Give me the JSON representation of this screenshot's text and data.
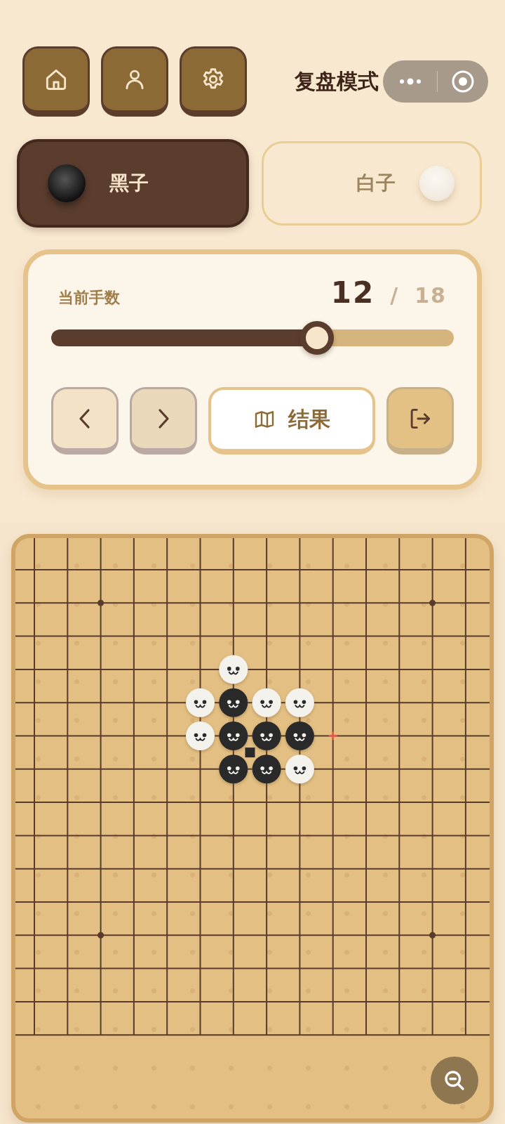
{
  "header": {
    "title": "复盘模式"
  },
  "players": [
    {
      "label": "黑子",
      "kind": "black",
      "selected": true
    },
    {
      "label": "白子",
      "kind": "white",
      "selected": false
    }
  ],
  "progress": {
    "label": "当前手数",
    "current": "12",
    "separator": "/",
    "total": "18",
    "level": 0.66
  },
  "actions": {
    "result_label": "结果"
  },
  "board": {
    "rows": [
      [
        {
          "kind": "empty"
        },
        {
          "kind": "empty"
        },
        {
          "kind": "empty"
        },
        {
          "kind": "empty"
        },
        {
          "kind": "empty"
        },
        {
          "kind": "empty"
        },
        {
          "kind": "empty"
        },
        {
          "kind": "empty"
        },
        {
          "kind": "empty"
        },
        {
          "kind": "empty"
        },
        {
          "kind": "empty"
        },
        {
          "kind": "empty"
        },
        {
          "kind": "empty"
        },
        {
          "kind": "empty"
        }
      ],
      [
        {
          "kind": "empty"
        },
        {
          "kind": "empty"
        },
        {
          "kind": "empty"
        },
        {
          "kind": "empty"
        },
        {
          "kind": "empty"
        },
        {
          "kind": "empty"
        },
        {
          "kind": "empty"
        },
        {
          "kind": "empty"
        },
        {
          "kind": "empty"
        },
        {
          "kind": "empty"
        },
        {
          "kind": "empty"
        },
        {
          "kind": "empty"
        },
        {
          "kind": "empty"
        },
        {
          "kind": "empty"
        }
      ],
      [
        {
          "kind": "empty"
        },
        {
          "kind": "empty"
        },
        {
          "kind": "empty"
        },
        {
          "kind": "empty"
        },
        {
          "kind": "empty"
        },
        {
          "kind": "empty"
        },
        {
          "kind": "empty"
        },
        {
          "kind": "empty"
        },
        {
          "kind": "empty"
        },
        {
          "kind": "empty"
        },
        {
          "kind": "empty"
        },
        {
          "kind": "empty"
        },
        {
          "kind": "empty"
        },
        {
          "kind": "empty"
        }
      ],
      [
        {
          "kind": "empty"
        },
        {
          "kind": "empty"
        },
        {
          "kind": "empty"
        },
        {
          "kind": "empty"
        },
        {
          "kind": "empty"
        },
        {
          "kind": "empty"
        },
        {
          "kind": "white"
        },
        {
          "kind": "empty"
        },
        {
          "kind": "empty"
        },
        {
          "kind": "empty"
        },
        {
          "kind": "empty"
        },
        {
          "kind": "empty"
        },
        {
          "kind": "empty"
        },
        {
          "kind": "empty"
        }
      ],
      [
        {
          "kind": "empty"
        },
        {
          "kind": "empty"
        },
        {
          "kind": "empty"
        },
        {
          "kind": "empty"
        },
        {
          "kind": "empty"
        },
        {
          "kind": "white"
        },
        {
          "kind": "black"
        },
        {
          "kind": "white"
        },
        {
          "kind": "white"
        },
        {
          "kind": "empty"
        },
        {
          "kind": "empty"
        },
        {
          "kind": "empty"
        },
        {
          "kind": "empty"
        },
        {
          "kind": "empty"
        }
      ],
      [
        {
          "kind": "empty"
        },
        {
          "kind": "empty"
        },
        {
          "kind": "empty"
        },
        {
          "kind": "empty"
        },
        {
          "kind": "empty"
        },
        {
          "kind": "white"
        },
        {
          "kind": "blackmarked"
        },
        {
          "kind": "black"
        },
        {
          "kind": "black"
        },
        {
          "kind": "hint"
        },
        {
          "kind": "empty"
        },
        {
          "kind": "empty"
        },
        {
          "kind": "empty"
        },
        {
          "kind": "empty"
        }
      ],
      [
        {
          "kind": "empty"
        },
        {
          "kind": "empty"
        },
        {
          "kind": "empty"
        },
        {
          "kind": "empty"
        },
        {
          "kind": "empty"
        },
        {
          "kind": "empty"
        },
        {
          "kind": "black"
        },
        {
          "kind": "black"
        },
        {
          "kind": "white"
        },
        {
          "kind": "empty"
        },
        {
          "kind": "empty"
        },
        {
          "kind": "empty"
        },
        {
          "kind": "empty"
        },
        {
          "kind": "empty"
        }
      ],
      [
        {
          "kind": "empty"
        },
        {
          "kind": "empty"
        },
        {
          "kind": "empty"
        },
        {
          "kind": "empty"
        },
        {
          "kind": "empty"
        },
        {
          "kind": "empty"
        },
        {
          "kind": "empty"
        },
        {
          "kind": "empty"
        },
        {
          "kind": "empty"
        },
        {
          "kind": "empty"
        },
        {
          "kind": "empty"
        },
        {
          "kind": "empty"
        },
        {
          "kind": "empty"
        },
        {
          "kind": "empty"
        }
      ],
      [
        {
          "kind": "empty"
        },
        {
          "kind": "empty"
        },
        {
          "kind": "empty"
        },
        {
          "kind": "empty"
        },
        {
          "kind": "empty"
        },
        {
          "kind": "empty"
        },
        {
          "kind": "empty"
        },
        {
          "kind": "empty"
        },
        {
          "kind": "empty"
        },
        {
          "kind": "empty"
        },
        {
          "kind": "empty"
        },
        {
          "kind": "empty"
        },
        {
          "kind": "empty"
        },
        {
          "kind": "empty"
        }
      ],
      [
        {
          "kind": "empty"
        },
        {
          "kind": "empty"
        },
        {
          "kind": "empty"
        },
        {
          "kind": "empty"
        },
        {
          "kind": "empty"
        },
        {
          "kind": "empty"
        },
        {
          "kind": "empty"
        },
        {
          "kind": "empty"
        },
        {
          "kind": "empty"
        },
        {
          "kind": "empty"
        },
        {
          "kind": "empty"
        },
        {
          "kind": "empty"
        },
        {
          "kind": "empty"
        },
        {
          "kind": "empty"
        }
      ],
      [
        {
          "kind": "empty"
        },
        {
          "kind": "empty"
        },
        {
          "kind": "empty"
        },
        {
          "kind": "empty"
        },
        {
          "kind": "empty"
        },
        {
          "kind": "empty"
        },
        {
          "kind": "empty"
        },
        {
          "kind": "empty"
        },
        {
          "kind": "empty"
        },
        {
          "kind": "empty"
        },
        {
          "kind": "empty"
        },
        {
          "kind": "empty"
        },
        {
          "kind": "empty"
        },
        {
          "kind": "empty"
        }
      ],
      [
        {
          "kind": "empty"
        },
        {
          "kind": "empty"
        },
        {
          "kind": "empty"
        },
        {
          "kind": "empty"
        },
        {
          "kind": "empty"
        },
        {
          "kind": "empty"
        },
        {
          "kind": "empty"
        },
        {
          "kind": "empty"
        },
        {
          "kind": "empty"
        },
        {
          "kind": "empty"
        },
        {
          "kind": "empty"
        },
        {
          "kind": "empty"
        },
        {
          "kind": "empty"
        },
        {
          "kind": "empty"
        }
      ],
      [
        {
          "kind": "empty"
        },
        {
          "kind": "empty"
        },
        {
          "kind": "empty"
        },
        {
          "kind": "empty"
        },
        {
          "kind": "empty"
        },
        {
          "kind": "empty"
        },
        {
          "kind": "empty"
        },
        {
          "kind": "empty"
        },
        {
          "kind": "empty"
        },
        {
          "kind": "empty"
        },
        {
          "kind": "empty"
        },
        {
          "kind": "empty"
        },
        {
          "kind": "empty"
        },
        {
          "kind": "empty"
        }
      ],
      [
        {
          "kind": "empty"
        },
        {
          "kind": "empty"
        },
        {
          "kind": "empty"
        },
        {
          "kind": "empty"
        },
        {
          "kind": "empty"
        },
        {
          "kind": "empty"
        },
        {
          "kind": "empty"
        },
        {
          "kind": "empty"
        },
        {
          "kind": "empty"
        },
        {
          "kind": "empty"
        },
        {
          "kind": "empty"
        },
        {
          "kind": "empty"
        },
        {
          "kind": "empty"
        },
        {
          "kind": "empty"
        }
      ],
      [
        {
          "kind": "empty"
        },
        {
          "kind": "empty"
        },
        {
          "kind": "empty"
        },
        {
          "kind": "empty"
        },
        {
          "kind": "empty"
        },
        {
          "kind": "empty"
        },
        {
          "kind": "empty"
        },
        {
          "kind": "empty"
        },
        {
          "kind": "empty"
        },
        {
          "kind": "empty"
        },
        {
          "kind": "empty"
        },
        {
          "kind": "empty"
        },
        {
          "kind": "empty"
        },
        {
          "kind": "empty"
        }
      ]
    ]
  }
}
